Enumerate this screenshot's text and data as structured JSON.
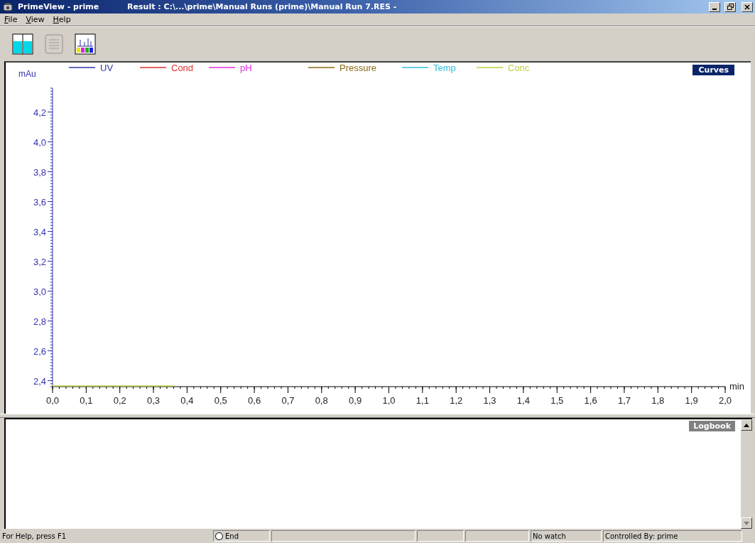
{
  "window": {
    "title": "PrimeView - prime",
    "document_title": "Result : C:\\...\\prime\\Manual Runs (prime)\\Manual Run 7.RES -"
  },
  "menu": [
    "File",
    "View",
    "Help"
  ],
  "toolbar": [
    {
      "kind": "columns"
    },
    {
      "kind": "notebook"
    },
    {
      "kind": "chromatogram"
    }
  ],
  "chart": {
    "curves_button": "Curves",
    "chart_data": {
      "type": "line",
      "xlabel": "min",
      "ylabel": "mAu",
      "xlim": [
        0,
        2
      ],
      "ylim": [
        2.36,
        4.36
      ],
      "xticks": [
        {
          "value": 0,
          "label": "0,0"
        },
        {
          "value": 0.1,
          "label": "0,1"
        },
        {
          "value": 0.2,
          "label": "0,2"
        },
        {
          "value": 0.3,
          "label": "0,3"
        },
        {
          "value": 0.4,
          "label": "0,4"
        },
        {
          "value": 0.5,
          "label": "0,5"
        },
        {
          "value": 0.6,
          "label": "0,6"
        },
        {
          "value": 0.7,
          "label": "0,7"
        },
        {
          "value": 0.8,
          "label": "0,8"
        },
        {
          "value": 0.9,
          "label": "0,9"
        },
        {
          "value": 1,
          "label": "1,0"
        },
        {
          "value": 1.1,
          "label": "1,1"
        },
        {
          "value": 1.2,
          "label": "1,2"
        },
        {
          "value": 1.3,
          "label": "1,3"
        },
        {
          "value": 1.4,
          "label": "1,4"
        },
        {
          "value": 1.5,
          "label": "1,5"
        },
        {
          "value": 1.6,
          "label": "1,6"
        },
        {
          "value": 1.7,
          "label": "1,7"
        },
        {
          "value": 1.8,
          "label": "1,8"
        },
        {
          "value": 1.9,
          "label": "1,9"
        },
        {
          "value": 2,
          "label": "2,0"
        }
      ],
      "yticks": [
        {
          "value": 2.4,
          "label": "2,4"
        },
        {
          "value": 2.6,
          "label": "2,6"
        },
        {
          "value": 2.8,
          "label": "2,8"
        },
        {
          "value": 3,
          "label": "3,0"
        },
        {
          "value": 3.2,
          "label": "3,2"
        },
        {
          "value": 3.4,
          "label": "3,4"
        },
        {
          "value": 3.6,
          "label": "3,6"
        },
        {
          "value": 3.8,
          "label": "3,8"
        },
        {
          "value": 4,
          "label": "4,0"
        },
        {
          "value": 4.2,
          "label": "4,2"
        }
      ],
      "x": [
        0,
        0.36
      ],
      "series": [
        {
          "name": "UV",
          "color": "#3333aa",
          "values": [
            null,
            null
          ]
        },
        {
          "name": "Cond",
          "color": "#e03030",
          "values": [
            null,
            null
          ]
        },
        {
          "name": "pH",
          "color": "#e030e0",
          "values": [
            null,
            null
          ]
        },
        {
          "name": "Pressure",
          "color": "#8b6914",
          "values": [
            null,
            null
          ]
        },
        {
          "name": "Temp",
          "color": "#30c0e0",
          "values": [
            null,
            null
          ]
        },
        {
          "name": "Conc",
          "color": "#c0d040",
          "values": [
            2.365,
            2.365
          ]
        }
      ]
    }
  },
  "logbook": {
    "label": "Logbook"
  },
  "status_bar": [
    {
      "kind": "text",
      "text": "For Help, press F1"
    },
    {
      "kind": "radio",
      "text": "End",
      "checked": false
    },
    {
      "kind": "empty"
    },
    {
      "kind": "empty"
    },
    {
      "kind": "empty"
    },
    {
      "kind": "text",
      "text": "No watch"
    },
    {
      "kind": "text",
      "text": "Controlled By: prime"
    }
  ]
}
